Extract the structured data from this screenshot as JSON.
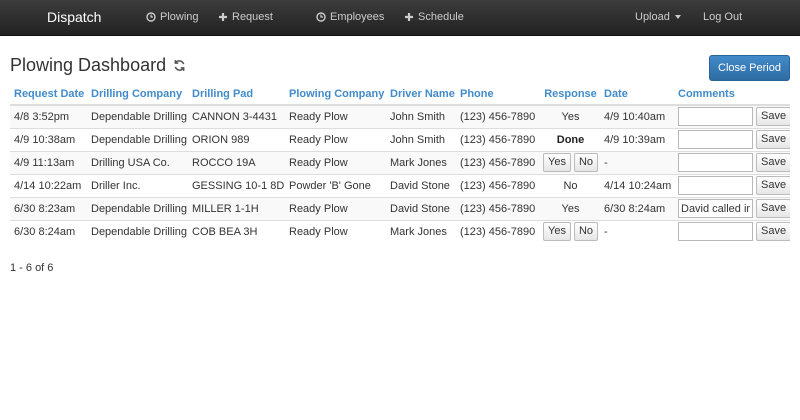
{
  "nav": {
    "brand": "Dispatch",
    "links": {
      "plowing": "Plowing",
      "request": "Request",
      "employees": "Employees",
      "schedule": "Schedule",
      "upload": "Upload",
      "logout": "Log Out"
    }
  },
  "page": {
    "title": "Plowing Dashboard",
    "close_period": "Close Period",
    "pager": "1 - 6 of 6"
  },
  "table": {
    "headers": {
      "request_date": "Request Date",
      "drilling_company": "Drilling Company",
      "drilling_pad": "Drilling Pad",
      "plowing_company": "Plowing Company",
      "driver_name": "Driver Name",
      "phone": "Phone",
      "response": "Response",
      "date": "Date",
      "comments": "Comments"
    },
    "yes_label": "Yes",
    "no_label": "No",
    "save_label": "Save",
    "rows": [
      {
        "request_date": "4/8 3:52pm",
        "drilling_company": "Dependable Drilling",
        "drilling_pad": "CANNON 3-4431",
        "plowing_company": "Ready Plow",
        "driver_name": "John Smith",
        "phone": "(123) 456-7890",
        "response": "Yes",
        "date": "4/9 10:40am",
        "comment": ""
      },
      {
        "request_date": "4/9 10:38am",
        "drilling_company": "Dependable Drilling",
        "drilling_pad": "ORION 989",
        "plowing_company": "Ready Plow",
        "driver_name": "John Smith",
        "phone": "(123) 456-7890",
        "response": "Done",
        "date": "4/9 10:39am",
        "comment": ""
      },
      {
        "request_date": "4/9 11:13am",
        "drilling_company": "Drilling USA Co.",
        "drilling_pad": "ROCCO 19A",
        "plowing_company": "Ready Plow",
        "driver_name": "Mark Jones",
        "phone": "(123) 456-7890",
        "response": "",
        "date": "-",
        "comment": ""
      },
      {
        "request_date": "4/14 10:22am",
        "drilling_company": "Driller Inc.",
        "drilling_pad": "GESSING 10-1 8D",
        "plowing_company": "Powder 'B' Gone",
        "driver_name": "David Stone",
        "phone": "(123) 456-7890",
        "response": "No",
        "date": "4/14 10:24am",
        "comment": ""
      },
      {
        "request_date": "6/30 8:23am",
        "drilling_company": "Dependable Drilling",
        "drilling_pad": "MILLER 1-1H",
        "plowing_company": "Ready Plow",
        "driver_name": "David Stone",
        "phone": "(123) 456-7890",
        "response": "Yes",
        "date": "6/30 8:24am",
        "comment": "David called in"
      },
      {
        "request_date": "6/30 8:24am",
        "drilling_company": "Dependable Drilling",
        "drilling_pad": "COB BEA 3H",
        "plowing_company": "Ready Plow",
        "driver_name": "Mark Jones",
        "phone": "(123) 456-7890",
        "response": "",
        "date": "-",
        "comment": ""
      }
    ]
  }
}
